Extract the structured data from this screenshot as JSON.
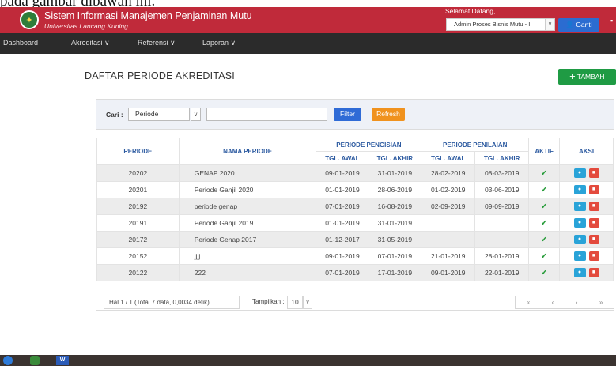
{
  "caption": "pada gambar dibawah ini.",
  "header": {
    "app_title": "Sistem Informasi Manajemen Penjaminan Mutu",
    "app_subtitle": "Universitas Lancang Kuning",
    "welcome_text": "Selamat Datang,",
    "role_value": "Admin Proses Bisnis Mutu - I",
    "ganti_label": "Ganti"
  },
  "nav": [
    {
      "label": "Dashboard"
    },
    {
      "label": "Akreditasi ∨"
    },
    {
      "label": "Referensi ∨"
    },
    {
      "label": "Laporan ∨"
    }
  ],
  "page": {
    "title": "DAFTAR PERIODE AKREDITASI",
    "tambah_label": "TAMBAH"
  },
  "filter": {
    "cari_label": "Cari :",
    "field_value": "Periode",
    "search_value": "",
    "filter_label": "Filter",
    "refresh_label": "Refresh"
  },
  "table": {
    "headers": {
      "periode": "PERIODE",
      "nama_periode": "NAMA PERIODE",
      "periode_pengisian": "PERIODE PENGISIAN",
      "periode_penilaian": "PERIODE PENILAIAN",
      "aktif": "AKTIF",
      "aksi": "AKSI",
      "tgl_awal": "TGL. AWAL",
      "tgl_akhir": "TGL. AKHIR"
    },
    "rows": [
      {
        "periode": "20202",
        "nama": "GENAP 2020",
        "isi_awal": "09-01-2019",
        "isi_akhir": "31-01-2019",
        "nilai_awal": "28-02-2019",
        "nilai_akhir": "08-03-2019",
        "aktif": "✔"
      },
      {
        "periode": "20201",
        "nama": "Periode Ganjil 2020",
        "isi_awal": "01-01-2019",
        "isi_akhir": "28-06-2019",
        "nilai_awal": "01-02-2019",
        "nilai_akhir": "03-06-2019",
        "aktif": "✔"
      },
      {
        "periode": "20192",
        "nama": "periode genap",
        "isi_awal": "07-01-2019",
        "isi_akhir": "16-08-2019",
        "nilai_awal": "02-09-2019",
        "nilai_akhir": "09-09-2019",
        "aktif": "✔"
      },
      {
        "periode": "20191",
        "nama": "Periode Ganjil 2019",
        "isi_awal": "01-01-2019",
        "isi_akhir": "31-01-2019",
        "nilai_awal": "",
        "nilai_akhir": "",
        "aktif": "✔"
      },
      {
        "periode": "20172",
        "nama": "Periode Genap 2017",
        "isi_awal": "01-12-2017",
        "isi_akhir": "31-05-2019",
        "nilai_awal": "",
        "nilai_akhir": "",
        "aktif": "✔"
      },
      {
        "periode": "20152",
        "nama": "jjjj",
        "isi_awal": "09-01-2019",
        "isi_akhir": "07-01-2019",
        "nilai_awal": "21-01-2019",
        "nilai_akhir": "28-01-2019",
        "aktif": "✔"
      },
      {
        "periode": "20122",
        "nama": "222",
        "isi_awal": "07-01-2019",
        "isi_akhir": "17-01-2019",
        "nilai_awal": "09-01-2019",
        "nilai_akhir": "22-01-2019",
        "aktif": "✔"
      }
    ]
  },
  "pager": {
    "info": "Hal 1 / 1 (Total 7 data, 0,0034 detik)",
    "tampilkan_label": "Tampilkan :",
    "page_size": "10",
    "first": "«",
    "prev": "‹",
    "next": "›",
    "last": "»"
  },
  "taskbar": {
    "word_label": "W"
  },
  "icons": {
    "check": "check-icon",
    "view": "eye-icon",
    "delete": "trash-icon",
    "user": "user-icon",
    "plus": "plus-icon",
    "dropdown": "chevron-down-icon"
  },
  "colors": {
    "header_bg": "#c02a3a",
    "nav_bg": "#2b2b2b",
    "tambah": "#1f9b44",
    "filter": "#2f6bd6",
    "refresh": "#f0921e",
    "header_text": "#2c5aa0",
    "aktif": "#2a9d3c",
    "view": "#29a3d8",
    "delete": "#e34a3d"
  }
}
